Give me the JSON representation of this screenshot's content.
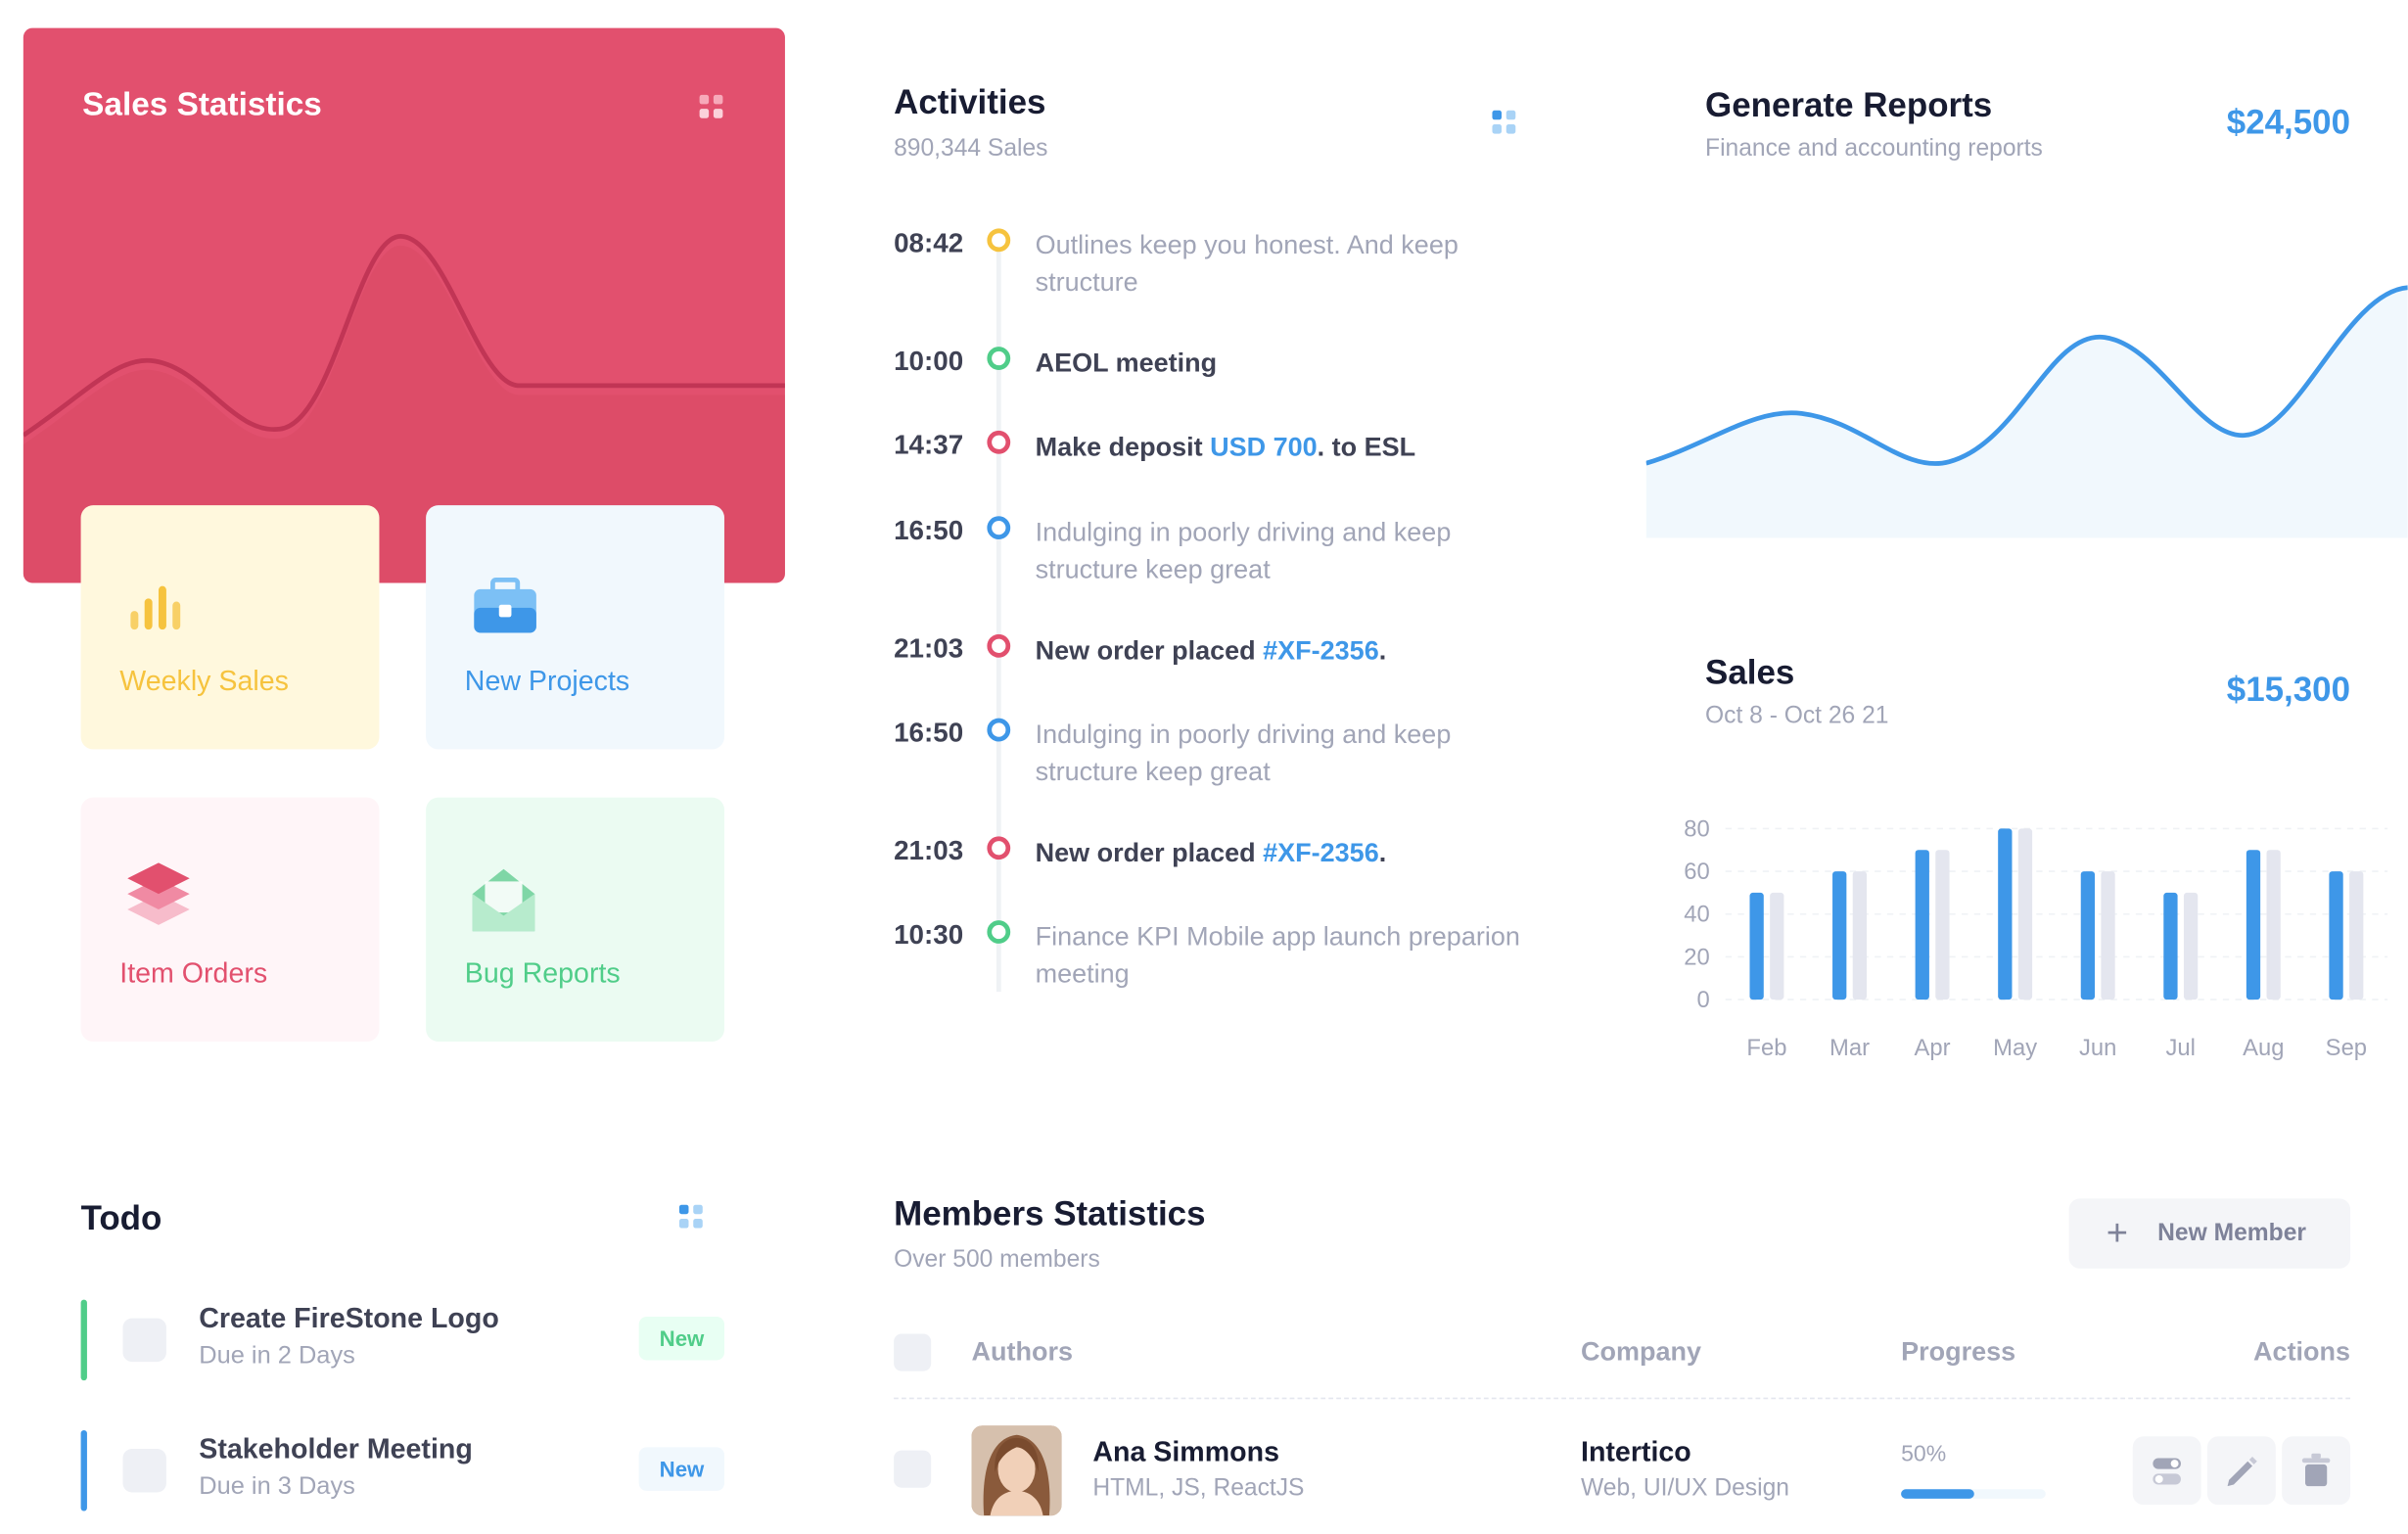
{
  "sales_statistics": {
    "title": "Sales Statistics",
    "tiles": [
      {
        "label": "Weekly Sales",
        "icon": "bar-chart-icon",
        "color": "#f6c33e",
        "bg": "#fff8dd"
      },
      {
        "label": "New Projects",
        "icon": "briefcase-icon",
        "color": "#3e97e8",
        "bg": "#f1f8fd"
      },
      {
        "label": "Item Orders",
        "icon": "layers-icon",
        "color": "#e2506e",
        "bg": "#fff5f8"
      },
      {
        "label": "Bug Reports",
        "icon": "envelope-icon",
        "color": "#50cd89",
        "bg": "#ebfbf2"
      }
    ]
  },
  "activities": {
    "title": "Activities",
    "subtitle": "890,344 Sales",
    "items": [
      {
        "time": "08:42",
        "color": "#f6c33e",
        "text": "Outlines keep you honest. And keep structure"
      },
      {
        "time": "10:00",
        "color": "#50cd89",
        "text": "AEOL meeting"
      },
      {
        "time": "14:37",
        "color": "#e2506e",
        "pre": "Make deposit ",
        "link": "USD 700",
        "post": ". to ESL"
      },
      {
        "time": "16:50",
        "color": "#3e97e8",
        "text": "Indulging in poorly driving and keep structure keep great"
      },
      {
        "time": "21:03",
        "color": "#e2506e",
        "pre": "New order placed ",
        "link": "#XF-2356",
        "post": "."
      },
      {
        "time": "16:50",
        "color": "#3e97e8",
        "text": "Indulging in poorly driving and keep structure keep great"
      },
      {
        "time": "21:03",
        "color": "#e2506e",
        "pre": "New order placed ",
        "link": "#XF-2356",
        "post": "."
      },
      {
        "time": "10:30",
        "color": "#50cd89",
        "text": "Finance KPI Mobile app launch preparion meeting"
      }
    ]
  },
  "generate_reports": {
    "title": "Generate Reports",
    "subtitle": "Finance and accounting reports",
    "amount": "$24,500"
  },
  "sales": {
    "title": "Sales",
    "subtitle": "Oct 8 - Oct 26 21",
    "amount": "$15,300"
  },
  "chart_data": {
    "type": "bar",
    "categories": [
      "Feb",
      "Mar",
      "Apr",
      "May",
      "Jun",
      "Jul",
      "Aug",
      "Sep"
    ],
    "series": [
      {
        "values": [
          50,
          60,
          70,
          80,
          60,
          50,
          70,
          60
        ],
        "color": "#3e97e8"
      },
      {
        "values": [
          50,
          60,
          70,
          80,
          60,
          50,
          70,
          60
        ],
        "color": "#e4e6ef"
      }
    ],
    "y_ticks": [
      "80",
      "60",
      "40",
      "20",
      "0"
    ],
    "ylim": [
      0,
      80
    ],
    "grid": true
  },
  "todo": {
    "title": "Todo",
    "items": [
      {
        "title": "Create FireStone Logo",
        "due": "Due in 2 Days",
        "badge": "New",
        "bar_color": "#50cd89",
        "badge_color": "#50cd89",
        "badge_bg": "#e8fff3"
      },
      {
        "title": "Stakeholder Meeting",
        "due": "Due in 3 Days",
        "badge": "New",
        "bar_color": "#3e97e8",
        "badge_color": "#3e97e8",
        "badge_bg": "#f1f8fd"
      }
    ]
  },
  "members": {
    "title": "Members Statistics",
    "subtitle": "Over 500 members",
    "new_button": "New Member",
    "columns": [
      "Authors",
      "Company",
      "Progress",
      "Actions"
    ],
    "rows": [
      {
        "name": "Ana Simmons",
        "skills": "HTML, JS, ReactJS",
        "company": "Intertico",
        "company_sub": "Web, UI/UX Design",
        "progress_label": "50%",
        "progress": 0.5
      }
    ]
  }
}
